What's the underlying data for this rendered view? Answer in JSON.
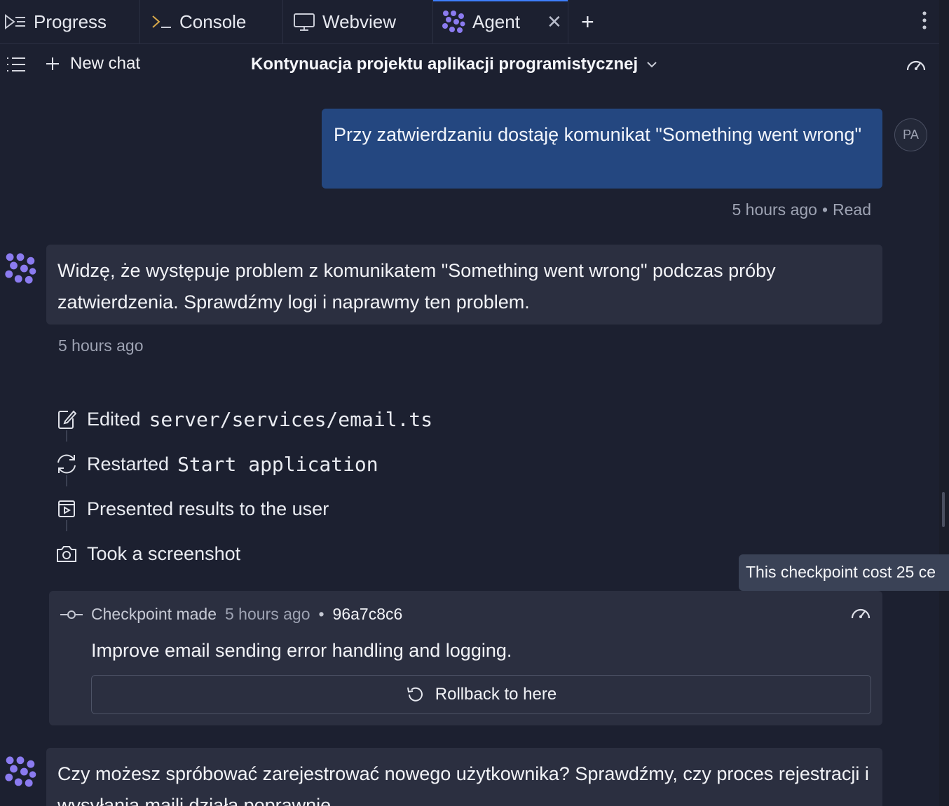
{
  "tabs": [
    {
      "label": "Progress",
      "icon": "progress-icon"
    },
    {
      "label": "Console",
      "icon": "terminal-icon"
    },
    {
      "label": "Webview",
      "icon": "monitor-icon"
    },
    {
      "label": "Agent",
      "icon": "agent-logo-icon",
      "active": true
    }
  ],
  "toolbar": {
    "new_chat_label": "New chat",
    "chat_title": "Kontynuacja projektu aplikacji programistycznej"
  },
  "user_message": {
    "avatar_initials": "PA",
    "text": "Przy zatwierdzaniu dostaję komunikat \"Something went wrong\"",
    "time": "5 hours ago",
    "status": "Read"
  },
  "agent_message_1": {
    "text": "Widzę, że występuje problem z komunikatem \"Something went wrong\" podczas próby zatwierdzenia. Sprawdźmy logi i naprawmy ten problem.",
    "time": "5 hours ago"
  },
  "actions": [
    {
      "verb": "Edited",
      "target": "server/services/email.ts",
      "icon": "edit-file-icon"
    },
    {
      "verb": "Restarted",
      "target": "Start application",
      "icon": "restart-icon"
    },
    {
      "verb": "Presented results to the user",
      "target": "",
      "icon": "present-icon"
    },
    {
      "verb": "Took a screenshot",
      "target": "",
      "icon": "camera-icon"
    }
  ],
  "tooltip": "This checkpoint cost 25 ce",
  "checkpoint": {
    "label": "Checkpoint made",
    "time": "5 hours ago",
    "hash": "96a7c8c6",
    "description": "Improve email sending error handling and logging.",
    "rollback_label": "Rollback to here"
  },
  "agent_message_2": {
    "text": "Czy możesz spróbować zarejestrować nowego użytkownika? Sprawdźmy, czy proces rejestracji i wysyłania maili działa poprawnie."
  },
  "colors": {
    "background": "#1c2030",
    "user_bubble": "#244780",
    "agent_bubble": "#2b2f40",
    "agent_logo": "#8b7bf0",
    "active_tab_accent": "#3d7eff"
  }
}
